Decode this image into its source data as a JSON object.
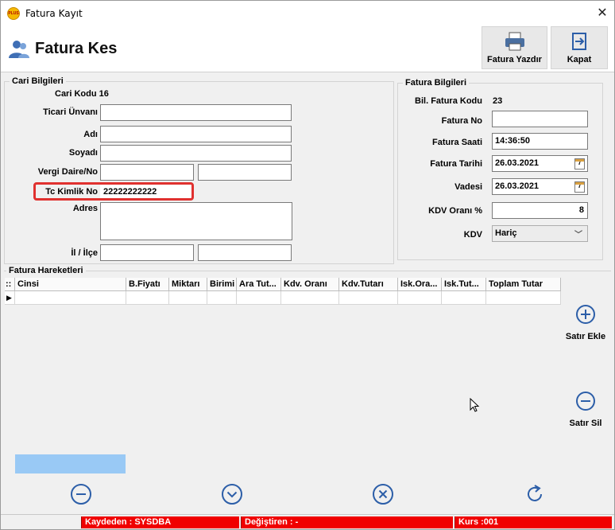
{
  "window": {
    "title": "Fatura Kayıt",
    "app_icon_text": "PLUS",
    "close_glyph": "✕"
  },
  "header": {
    "title": "Fatura Kes",
    "print_label": "Fatura Yazdır",
    "close_label": "Kapat"
  },
  "cari": {
    "group_title": "Cari Bilgileri",
    "kod_label": "Cari Kodu",
    "kod_value": "16",
    "ticari_label": "Ticari Ünvanı",
    "ticari_value": "",
    "adi_label": "Adı",
    "adi_value": "",
    "soyadi_label": "Soyadı",
    "soyadi_value": "",
    "vergi_label": "Vergi Daire/No",
    "vergi_daire_value": "",
    "vergi_no_value": "",
    "tc_label": "Tc Kimlik No",
    "tc_value": "22222222222",
    "adres_label": "Adres",
    "adres_value": "",
    "il_label": "İl / İlçe",
    "il_value": "",
    "ilce_value": ""
  },
  "fatura": {
    "group_title": "Fatura Bilgileri",
    "kod_label": "Bil. Fatura Kodu",
    "kod_value": "23",
    "no_label": "Fatura No",
    "no_value": "",
    "saat_label": "Fatura Saati",
    "saat_value": "14:36:50",
    "tarih_label": "Fatura Tarihi",
    "tarih_value": "26.03.2021",
    "vade_label": "Vadesi",
    "vade_value": "26.03.2021",
    "kdv_oran_label": "KDV Oranı %",
    "kdv_oran_value": "8",
    "kdv_label": "KDV",
    "kdv_value": "Hariç",
    "calendar_glyph": "7"
  },
  "hareket": {
    "group_title": "Fatura Hareketleri",
    "columns": [
      "Cinsi",
      "B.Fiyatı",
      "Miktarı",
      "Birimi",
      "Ara Tut...",
      "Kdv. Oranı",
      "Kdv.Tutarı",
      "Isk.Ora...",
      "Isk.Tut...",
      "Toplam Tutar"
    ],
    "add_label": "Satır Ekle",
    "remove_label": "Satır Sil",
    "indicator": "::",
    "row_marker": "▶"
  },
  "status": {
    "kaydeden": "Kaydeden : SYSDBA",
    "degistiren": "Değiştiren :  -",
    "kurs": "Kurs :001"
  },
  "colors": {
    "accent_blue": "#2c5ea8",
    "status_red": "#f00000",
    "highlight_red": "#e0312f"
  }
}
